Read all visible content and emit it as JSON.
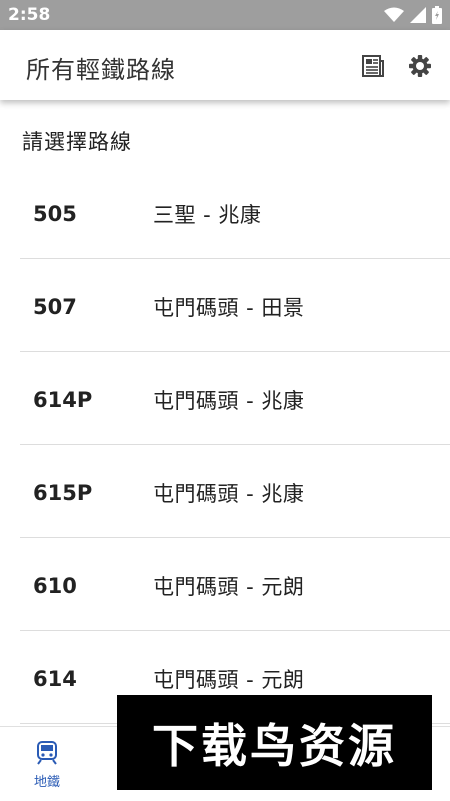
{
  "status_bar": {
    "time": "2:58",
    "icons": [
      "wifi-icon",
      "signal-icon",
      "battery-icon"
    ]
  },
  "app_bar": {
    "title": "所有輕鐵路線",
    "actions": [
      "news-icon",
      "settings-gear-icon"
    ]
  },
  "section": {
    "title": "請選擇路線"
  },
  "routes": [
    {
      "number": "505",
      "name": "三聖 - 兆康"
    },
    {
      "number": "507",
      "name": "屯門碼頭 - 田景"
    },
    {
      "number": "614P",
      "name": "屯門碼頭 - 兆康"
    },
    {
      "number": "615P",
      "name": "屯門碼頭 - 兆康"
    },
    {
      "number": "610",
      "name": "屯門碼頭 - 元朗"
    },
    {
      "number": "614",
      "name": "屯門碼頭 - 元朗"
    }
  ],
  "bottom_nav": {
    "items": [
      {
        "label": "地鐵",
        "icon": "train-icon",
        "active": true
      }
    ]
  },
  "watermark": {
    "text": "下载鸟资源"
  },
  "colors": {
    "status_bar": "#9e9e9e",
    "accent": "#2a5bb5",
    "divider": "#dddddd"
  }
}
